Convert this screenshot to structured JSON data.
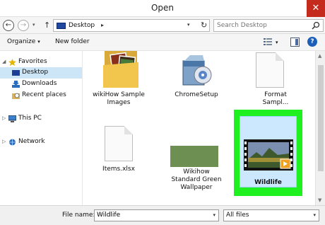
{
  "window": {
    "title": "Open",
    "close_glyph": "✕"
  },
  "address": {
    "back_glyph": "←",
    "forward_glyph": "→",
    "up_glyph": "↑",
    "path_label": "Desktop",
    "path_separator": "▸",
    "dropdown_glyph": "▾",
    "refresh_glyph": "↻",
    "search_placeholder": "Search Desktop"
  },
  "toolbar": {
    "organize_label": "Organize",
    "organize_dd": "▾",
    "new_folder_label": "New folder",
    "view_dd": "▾",
    "help_glyph": "?"
  },
  "sidebar": {
    "items": [
      {
        "label": "Favorites",
        "icon": "star-icon"
      },
      {
        "label": "Desktop",
        "icon": "desktop-icon",
        "selected": true
      },
      {
        "label": "Downloads",
        "icon": "downloads-icon"
      },
      {
        "label": "Recent places",
        "icon": "recent-places-icon"
      },
      {
        "label": "This PC",
        "icon": "computer-icon"
      },
      {
        "label": "Network",
        "icon": "network-icon"
      }
    ],
    "expand_glyph": "▷"
  },
  "files": [
    {
      "label_line1": "wikiHow Sample",
      "label_line2": "Images",
      "kind": "folder"
    },
    {
      "label_line1": "ChromeSetup",
      "kind": "installer"
    },
    {
      "label_line1": "Format",
      "label_line2": "Sampl...",
      "kind": "document"
    },
    {
      "label_line1": "Items.xlsx",
      "kind": "document"
    },
    {
      "label_line1": "Wikihow",
      "label_line2": "Standard Green",
      "label_line3": "Wallpaper",
      "kind": "image"
    },
    {
      "label_line1": "Wildlife",
      "kind": "video",
      "selected": true
    }
  ],
  "footer": {
    "file_name_label": "File name:",
    "file_name_value": "Wildlife",
    "file_type_value": "All files",
    "dropdown_glyph": "▾"
  },
  "colors": {
    "highlight": "#1ff01f",
    "selection": "#cce8ff",
    "close": "#c42b1c",
    "wallpaper_green": "#6e8f52"
  }
}
